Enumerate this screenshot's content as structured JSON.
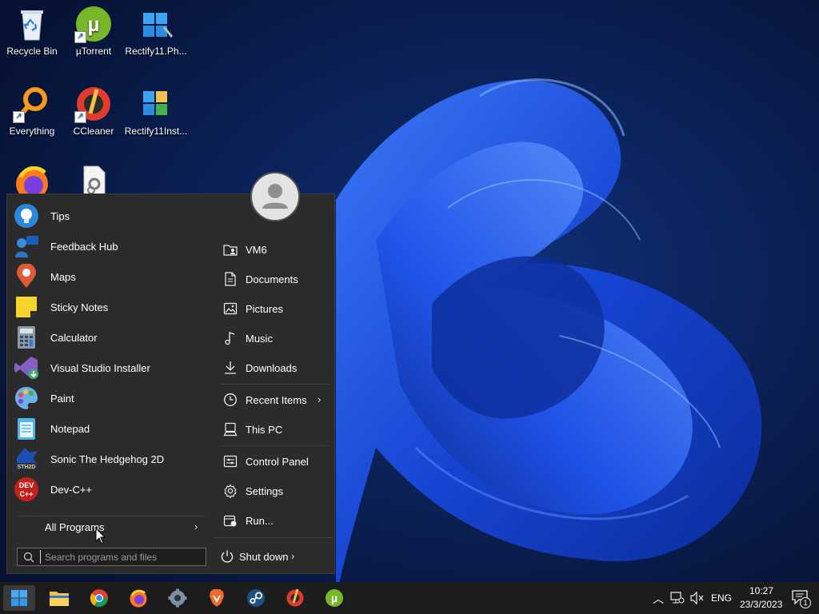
{
  "desktop": {
    "icons": [
      {
        "label": "Recycle Bin",
        "icon": "recycle-bin-icon"
      },
      {
        "label": "µTorrent",
        "icon": "utorrent-icon"
      },
      {
        "label": "Rectify11.Ph...",
        "icon": "rectify11-icon"
      },
      {
        "label": "Everything",
        "icon": "everything-search-icon"
      },
      {
        "label": "CCleaner",
        "icon": "ccleaner-icon"
      },
      {
        "label": "Rectify11Inst...",
        "icon": "rectify11-installer-icon"
      },
      {
        "label": "",
        "icon": "firefox-icon"
      },
      {
        "label": "",
        "icon": "settings-file-icon"
      }
    ]
  },
  "start_menu": {
    "programs": [
      {
        "label": "Tips",
        "icon": "lightbulb-icon"
      },
      {
        "label": "Feedback Hub",
        "icon": "feedback-hub-icon"
      },
      {
        "label": "Maps",
        "icon": "map-pin-icon"
      },
      {
        "label": "Sticky Notes",
        "icon": "sticky-notes-icon"
      },
      {
        "label": "Calculator",
        "icon": "calculator-icon"
      },
      {
        "label": "Visual Studio Installer",
        "icon": "visual-studio-icon"
      },
      {
        "label": "Paint",
        "icon": "paint-palette-icon"
      },
      {
        "label": "Notepad",
        "icon": "notepad-icon"
      },
      {
        "label": "Sonic The Hedgehog 2D",
        "icon": "sonic-icon"
      },
      {
        "label": "Dev-C++",
        "icon": "devcpp-icon"
      }
    ],
    "all_programs_label": "All Programs",
    "search_placeholder": "Search programs and files",
    "places": [
      {
        "label": "VM6",
        "icon": "user-folder-icon"
      },
      {
        "label": "Documents",
        "icon": "document-icon"
      },
      {
        "label": "Pictures",
        "icon": "picture-icon"
      },
      {
        "label": "Music",
        "icon": "music-note-icon"
      },
      {
        "label": "Downloads",
        "icon": "download-arrow-icon"
      },
      {
        "label": "Recent Items",
        "icon": "clock-icon"
      },
      {
        "label": "This PC",
        "icon": "computer-icon"
      },
      {
        "label": "Control Panel",
        "icon": "control-panel-icon"
      },
      {
        "label": "Settings",
        "icon": "gear-icon"
      },
      {
        "label": "Run...",
        "icon": "run-icon"
      }
    ],
    "shutdown_label": "Shut down"
  },
  "taskbar": {
    "apps": [
      "start-icon",
      "file-explorer-icon",
      "chrome-icon",
      "firefox-icon",
      "settings-gear-icon",
      "brave-icon",
      "steam-icon",
      "ccleaner-icon",
      "utorrent-icon"
    ],
    "tray": {
      "language": "ENG",
      "time": "10:27",
      "date": "23/3/2023",
      "notification_count": "1"
    }
  },
  "colors": {
    "menu_bg": "#2b2b2b",
    "taskbar_bg": "#1c1c1c",
    "wallpaper_dark": "#0b1a3e",
    "wallpaper_bloom": "#1e5bff"
  }
}
